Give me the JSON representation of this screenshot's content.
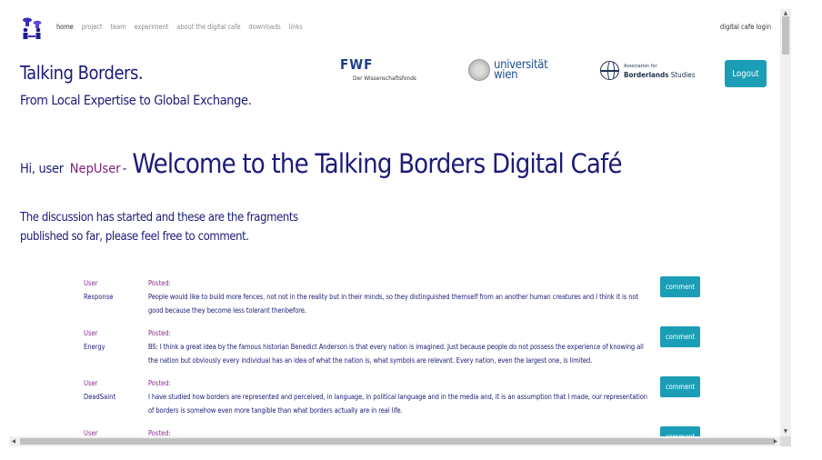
{
  "nav": {
    "links": [
      "home",
      "project",
      "team",
      "experiment",
      "about the digital cafe",
      "downloads",
      "links"
    ],
    "right_link": "digital cafe login"
  },
  "header": {
    "title": "Talking Borders.",
    "subtitle": "From Local Expertise to Global Exchange.",
    "logout_label": "Logout"
  },
  "partners": {
    "fwf_mark": "FWF",
    "fwf_sub": "Der Wissenschaftsfonds",
    "uni_line1": "universität",
    "uni_line2": "wien",
    "abs_small": "Association for",
    "abs_bold": "Borderlands",
    "abs_rest": " Studies"
  },
  "welcome": {
    "hi": "Hi, user",
    "username": "NepUser",
    "dash": "-",
    "title": "Welcome to the Talking Borders Digital Café"
  },
  "intro": "The discussion has started and these are the fragments published so far, please feel free to comment.",
  "fragments": {
    "user_label": "User",
    "posted_label": "Posted:",
    "comment_label": "comment",
    "rows": [
      {
        "user": "Response",
        "text": "People would like to build more fences, not not in the reality but in their minds, so they distinguished themself from an another human creatures and I think it is not good because they become less tolerant thenbefore."
      },
      {
        "user": "Energy",
        "text": "BS: I think a great idea by the famous historian Benedict Anderson is that every nation is imagined. Just because people do not possess the experience of knowing all the nation but obviously every individual has an idea of what the nation is, what symbols are relevant. Every nation, even the largest one, is limited."
      },
      {
        "user": "DeadSaint",
        "text": "I have studied how borders are represented and perceived, in language, in political language and in the media and, it is an assumption that I made, our representation of borders is somehow even more tangible than what borders actually are in real life."
      },
      {
        "user": "",
        "text": ""
      }
    ]
  },
  "scrollbars": {
    "up": "▲",
    "down": "▼",
    "left": "◀",
    "right": "▶"
  }
}
